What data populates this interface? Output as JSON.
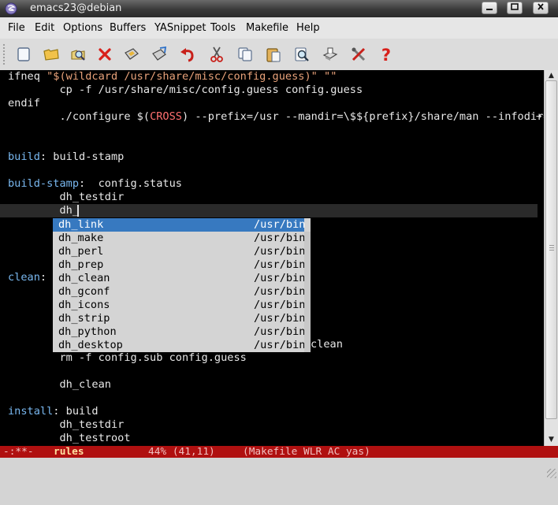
{
  "window": {
    "title": "emacs23@debian",
    "controls": [
      "minimize",
      "maximize",
      "close"
    ]
  },
  "menubar": {
    "items": [
      "File",
      "Edit",
      "Options",
      "Buffers",
      "YASnippet",
      "Tools",
      "Makefile",
      "Help"
    ]
  },
  "toolbar": {
    "buttons": [
      {
        "name": "new-file",
        "icon": "new-file-icon"
      },
      {
        "name": "open-folder",
        "icon": "folder-icon"
      },
      {
        "name": "dired",
        "icon": "dired-icon"
      },
      {
        "name": "close-buffer",
        "icon": "close-icon"
      },
      {
        "name": "save",
        "icon": "save-icon"
      },
      {
        "name": "save-as",
        "icon": "save-as-icon"
      },
      {
        "name": "undo",
        "icon": "undo-icon"
      },
      {
        "name": "cut",
        "icon": "scissors-icon"
      },
      {
        "name": "copy",
        "icon": "copy-icon"
      },
      {
        "name": "paste",
        "icon": "paste-icon"
      },
      {
        "name": "search",
        "icon": "search-icon"
      },
      {
        "name": "print",
        "icon": "print-icon"
      },
      {
        "name": "preferences",
        "icon": "tools-icon"
      },
      {
        "name": "help",
        "icon": "help-icon"
      }
    ]
  },
  "editor": {
    "lines": {
      "l0": {
        "kw": "ifneq ",
        "str": "\"$(wildcard /usr/share/misc/config.guess)\" \"\""
      },
      "l1": "        cp -f /usr/share/misc/config.guess config.guess",
      "l2": "endif",
      "l3": {
        "pre": "        ./configure $(",
        "macro": "CROSS",
        "post": ") --prefix=/usr --mandir=\\$${prefix}/share/man --infodir="
      },
      "l4": {
        "target": "build",
        "rest": ": build-stamp"
      },
      "l5": {
        "target": "build-stamp",
        "rest": ":  config.status"
      },
      "l6": "        dh_testdir",
      "l7": "        dh_",
      "l8": {
        "target": "clean",
        "rest": ":"
      },
      "l9_tail": "clean",
      "l10": "        rm -f config.sub config.guess",
      "l11": "        dh_clean",
      "l12": {
        "target": "install",
        "rest": ": build"
      },
      "l13": "        dh_testdir",
      "l14": "        dh_testroot"
    },
    "truncation_marker": "→"
  },
  "completion": {
    "items": [
      {
        "name": "dh_link",
        "path": "/usr/bin"
      },
      {
        "name": "dh_make",
        "path": "/usr/bin"
      },
      {
        "name": "dh_perl",
        "path": "/usr/bin"
      },
      {
        "name": "dh_prep",
        "path": "/usr/bin"
      },
      {
        "name": "dh_clean",
        "path": "/usr/bin"
      },
      {
        "name": "dh_gconf",
        "path": "/usr/bin"
      },
      {
        "name": "dh_icons",
        "path": "/usr/bin"
      },
      {
        "name": "dh_strip",
        "path": "/usr/bin"
      },
      {
        "name": "dh_python",
        "path": "/usr/bin"
      },
      {
        "name": "dh_desktop",
        "path": "/usr/bin"
      }
    ],
    "selected_index": 0
  },
  "modeline": {
    "status": "-:**-",
    "buffer": "rules",
    "position": "44% (41,11)",
    "modes": "(Makefile WLR AC yas)"
  },
  "colors": {
    "editor_bg": "#000000",
    "target": "#79b8f0",
    "string": "#e8a27a",
    "macro": "#ff7070",
    "selection": "#3779c0",
    "modeline_bg": "#b01010"
  }
}
